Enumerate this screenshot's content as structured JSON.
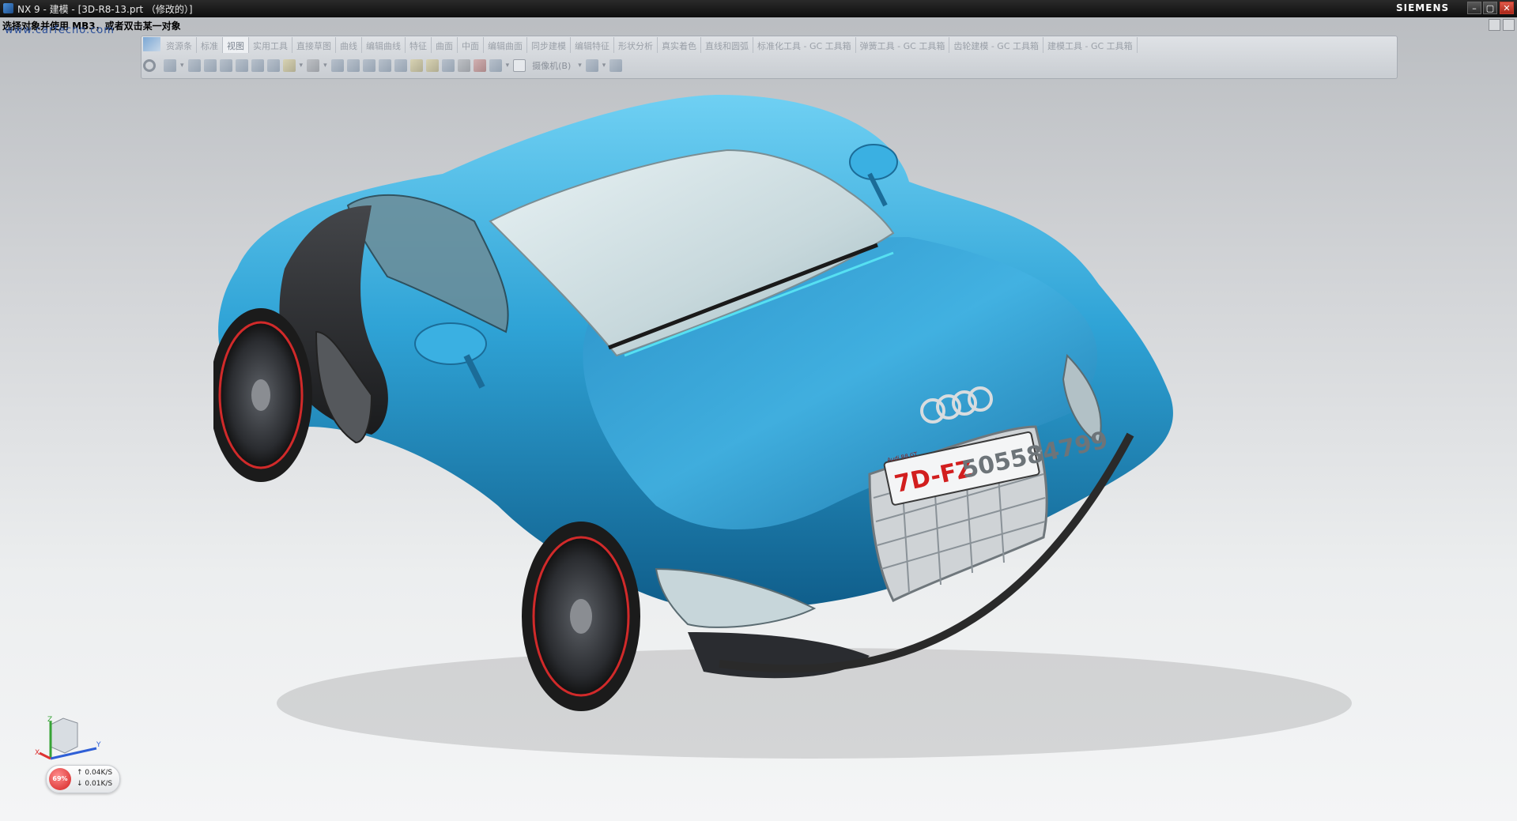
{
  "window": {
    "title": "NX 9 - 建模 - [3D-R8-13.prt （修改的）]",
    "brand": "SIEMENS",
    "controls": [
      "–",
      "▢",
      "✕"
    ]
  },
  "cue_line": "选择对象并使用 MB3，或者双击某一对象",
  "watermark": "www.carfecno.com",
  "ribbon": {
    "tabs": [
      "资源条",
      "标准",
      "视图",
      "实用工具",
      "直接草图",
      "曲线",
      "编辑曲线",
      "特征",
      "曲面",
      "中面",
      "编辑曲面",
      "同步建模",
      "编辑特征",
      "形状分析",
      "真实着色",
      "直线和圆弧",
      "标准化工具 - GC 工具箱",
      "弹簧工具 - GC 工具箱",
      "齿轮建模 - GC 工具箱",
      "建模工具 - GC 工具箱"
    ],
    "active_tab": "视图",
    "camera_label": "摄像机(B)"
  },
  "car": {
    "body_color": "#2fa3d6",
    "plate": {
      "prefix": "7D-FZ",
      "number": "505584799",
      "badge": "Audi R8 GT"
    }
  },
  "netmeter": {
    "percent": "69%",
    "upload": "0.04K/S",
    "download": "0.01K/S"
  },
  "triad": {
    "x_label": "X",
    "y_label": "Y",
    "z_label": "Z"
  }
}
